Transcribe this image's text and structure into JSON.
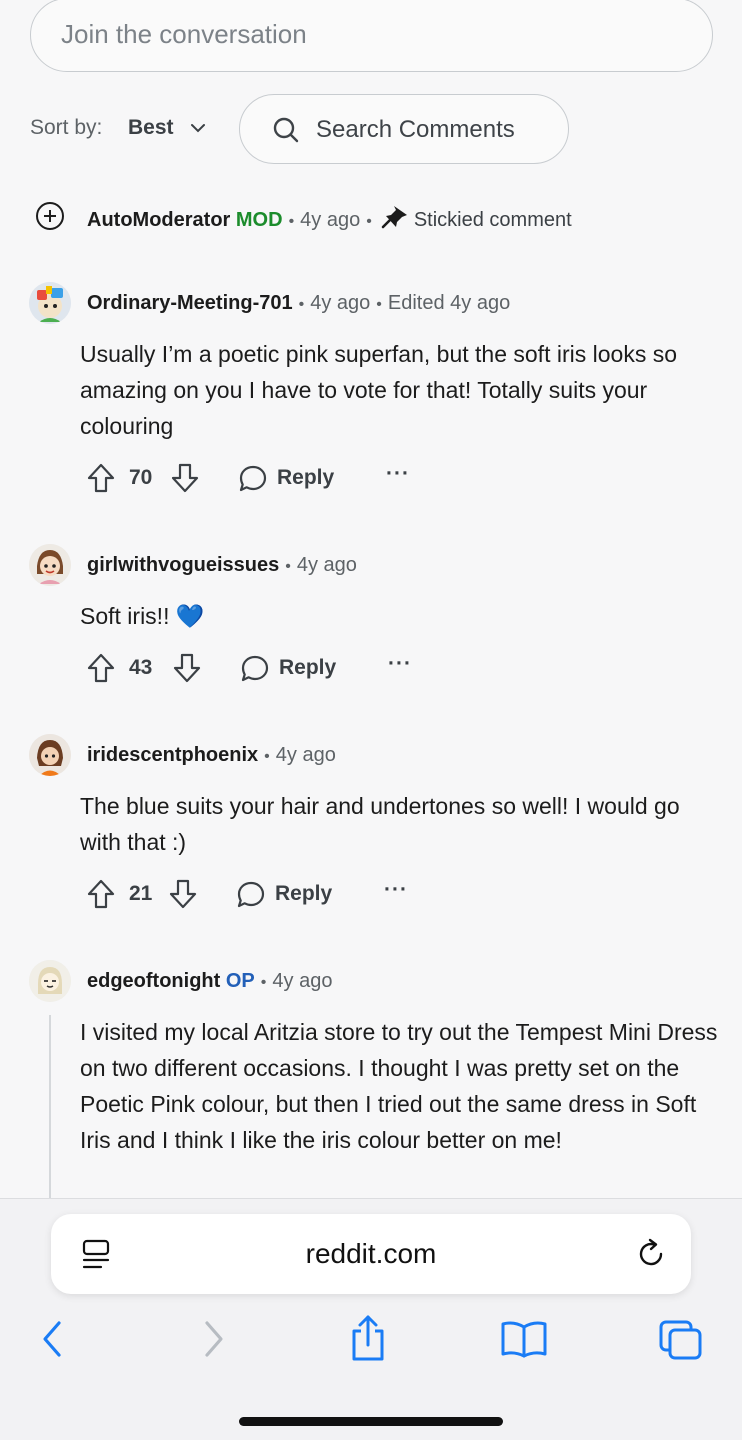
{
  "composer": {
    "placeholder": "Join the conversation"
  },
  "sort": {
    "label": "Sort by:",
    "value": "Best",
    "search_label": "Search Comments"
  },
  "sticky": {
    "author": "AutoModerator",
    "tag": "MOD",
    "time": "4y ago",
    "note": "Stickied comment"
  },
  "comments": [
    {
      "author": "Ordinary-Meeting-701",
      "time": "4y ago",
      "edited": "Edited 4y ago",
      "body": "Usually I’m a poetic pink superfan, but the soft iris looks so amazing on you I have to vote for that! Totally suits your colouring",
      "score": "70",
      "reply": "Reply",
      "more": "···"
    },
    {
      "author": "girlwithvogueissues",
      "time": "4y ago",
      "body": "Soft iris!! 💙",
      "score": "43",
      "reply": "Reply",
      "more": "···"
    },
    {
      "author": "iridescentphoenix",
      "time": "4y ago",
      "body": "The blue suits your hair and undertones so well! I would go with that :)",
      "score": "21",
      "reply": "Reply",
      "more": "···"
    },
    {
      "author": "edgeoftonight",
      "tag": "OP",
      "time": "4y ago",
      "body": "I visited my local Aritzia store to try out the Tempest Mini Dress on two different occasions. I thought I was pretty set on the Poetic Pink colour, but then I tried out the same dress in Soft Iris and I think I like the iris colour better on me!"
    }
  ],
  "browser": {
    "url": "reddit.com"
  },
  "colors": {
    "mod": "#1c8c2c",
    "op": "#2360b8",
    "ios_blue": "#1a7cf5"
  }
}
